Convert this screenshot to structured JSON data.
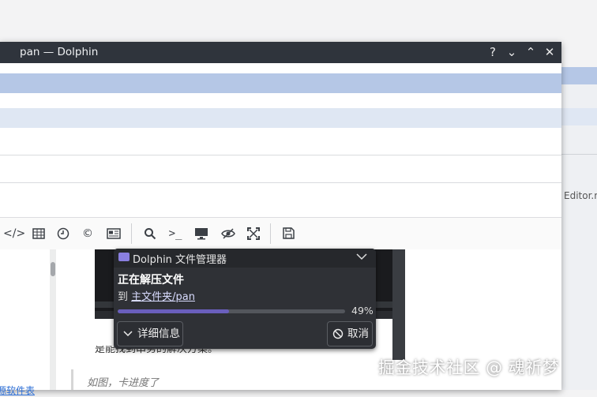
{
  "window": {
    "title": "pan — Dolphin",
    "buttons": {
      "help": "?",
      "minimize": "⌄",
      "maximize": "⌃",
      "close": "✕"
    }
  },
  "background_editor": {
    "label": "Editor.m"
  },
  "toolbar_icons": [
    "code-icon",
    "table-icon",
    "clock-icon",
    "copyright-icon",
    "layout-icon",
    "search-icon",
    "terminal-icon",
    "monitor-icon",
    "hide-icon",
    "fullscreen-icon",
    "save-icon"
  ],
  "content": {
    "truncated_line": "是能找到串务的解决方案。",
    "quote": "如图，卡进度了",
    "left_link": "源软件表"
  },
  "notification": {
    "app_name": "Dolphin 文件管理器",
    "title": "正在解压文件",
    "dest_prefix": "到 ",
    "dest_link": "主文件夹/pan",
    "progress": 0.49,
    "percent": "49%",
    "details_button": "详细信息",
    "cancel_button": "取消"
  },
  "watermark": "掘金技术社区 @ 魂祈梦",
  "colors": {
    "titlebar": "#2f343c",
    "highlight": "#b5c7e6",
    "light_highlight": "#dfe7f3",
    "progress": "#6a5fbd"
  }
}
